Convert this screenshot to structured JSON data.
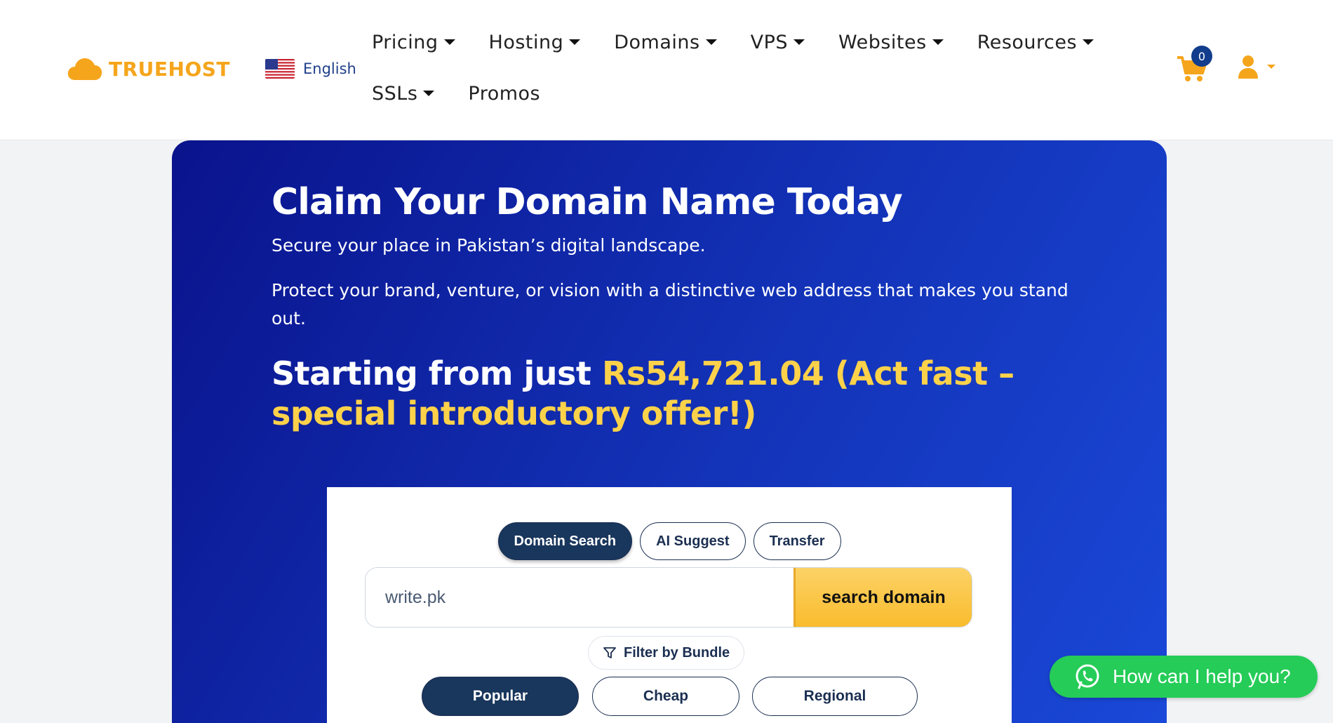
{
  "brand": {
    "name": "TRUEHOST",
    "color": "#f5a51c"
  },
  "language": {
    "label": "English",
    "flag": "us-flag-icon"
  },
  "nav": {
    "items": [
      {
        "label": "Pricing",
        "has_dropdown": true
      },
      {
        "label": "Hosting",
        "has_dropdown": true
      },
      {
        "label": "Domains",
        "has_dropdown": true
      },
      {
        "label": "VPS",
        "has_dropdown": true
      },
      {
        "label": "Websites",
        "has_dropdown": true
      },
      {
        "label": "Resources",
        "has_dropdown": true
      },
      {
        "label": "SSLs",
        "has_dropdown": true
      },
      {
        "label": "Promos",
        "has_dropdown": false
      }
    ]
  },
  "cart": {
    "count": "0",
    "icon": "shopping-cart-icon"
  },
  "account": {
    "icon": "user-icon"
  },
  "hero": {
    "title": "Claim Your Domain Name Today",
    "subtitle": "Secure your place in Pakistan’s digital landscape.",
    "description": "Protect your brand, venture, or vision with a distinctive web address that makes you stand out.",
    "price_prefix": "Starting from just ",
    "price_highlight": "Rs54,721.04 (Act fast – special introductory offer!)"
  },
  "search": {
    "tabs": [
      "Domain Search",
      "AI Suggest",
      "Transfer"
    ],
    "active_tab": "Domain Search",
    "input_value": "write.pk",
    "button_label": "search domain",
    "filter_label": "Filter by Bundle",
    "bundles": [
      "Popular",
      "Cheap",
      "Regional"
    ],
    "active_bundle": "Popular"
  },
  "whatsapp": {
    "label": "How can I help you?",
    "color": "#25cc58"
  },
  "colors": {
    "hero_start": "#0a138c",
    "hero_end": "#1a48d8",
    "navy": "#19365c",
    "accent_yellow": "#fdd24a"
  }
}
